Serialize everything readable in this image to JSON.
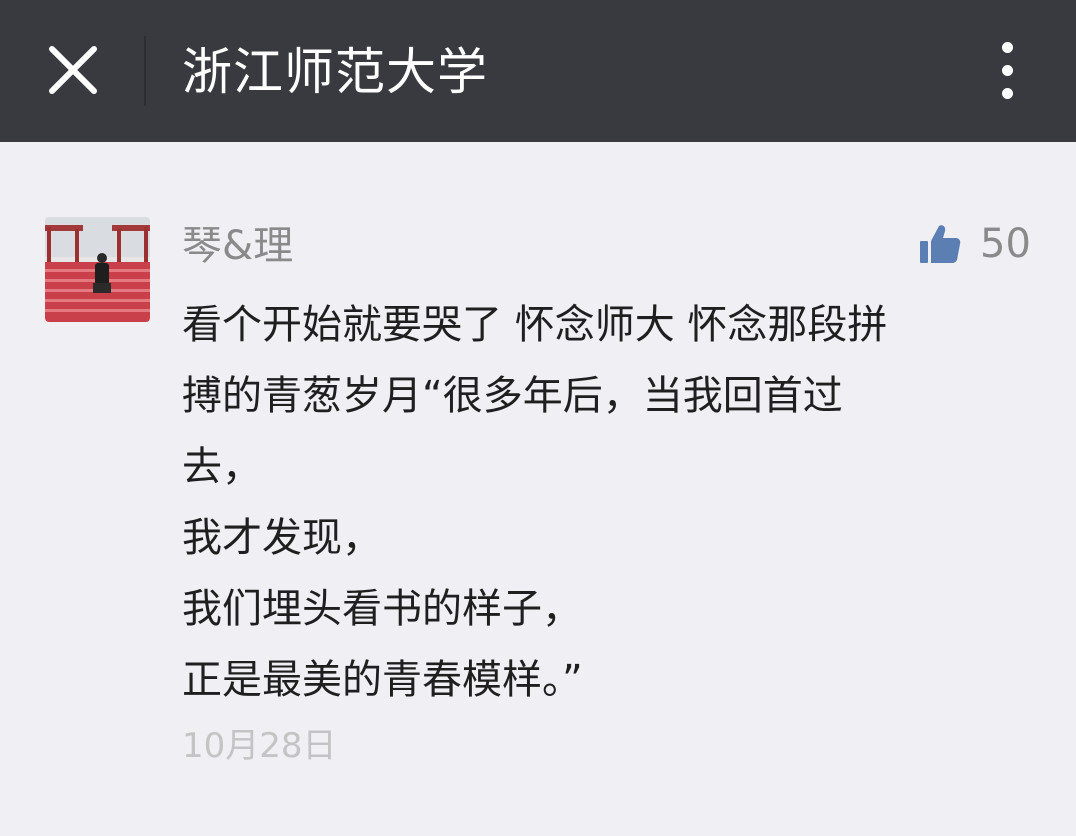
{
  "header": {
    "title": "浙江师范大学",
    "close_icon": "close-icon",
    "more_icon": "more-vertical-icon",
    "background_color": "#393a3f"
  },
  "comment": {
    "nickname": "琴&理",
    "like_icon": "thumbs-up-icon",
    "like_count": "50",
    "like_color": "#5b7fb3",
    "text_lines": [
      "看个开始就要哭了  怀念师大 怀念那段拼",
      "搏的青葱岁月“很多年后，当我回首过",
      "去，",
      "我才发现，",
      "我们埋头看书的样子，",
      "正是最美的青春模样。”"
    ],
    "date": "10月28日"
  }
}
